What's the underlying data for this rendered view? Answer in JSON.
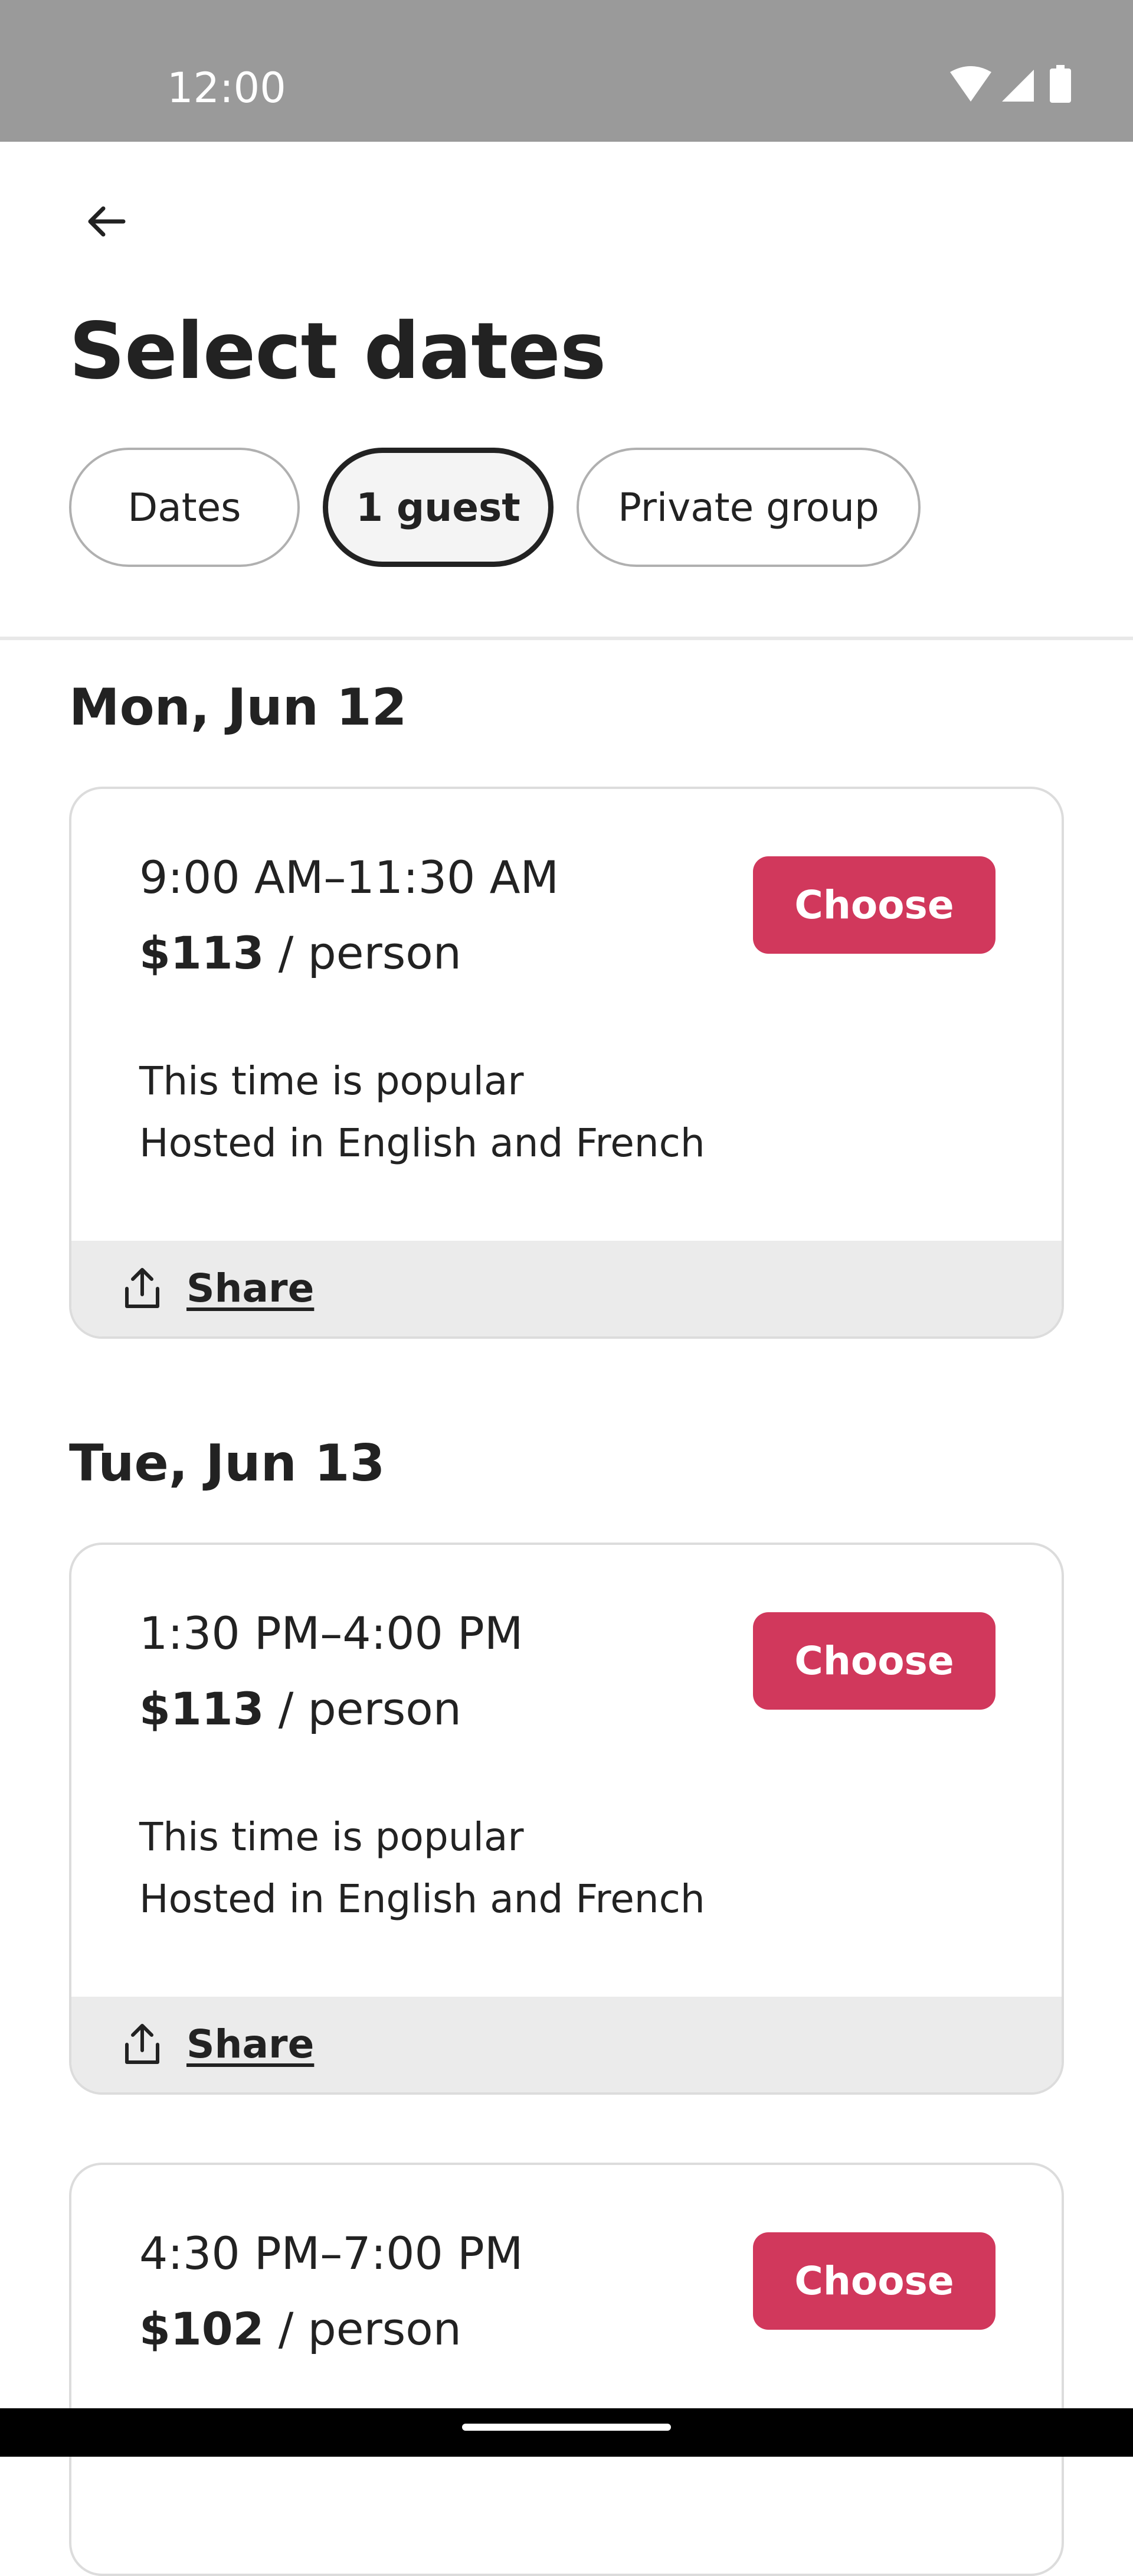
{
  "status_bar": {
    "time": "12:00",
    "icons": [
      "wifi-icon",
      "signal-icon",
      "battery-icon"
    ]
  },
  "header": {
    "back_icon": "arrow-left-icon",
    "title": "Select dates",
    "chips": [
      {
        "label": "Dates",
        "selected": false
      },
      {
        "label": "1 guest",
        "selected": true
      },
      {
        "label": "Private group",
        "selected": false
      }
    ]
  },
  "days": [
    {
      "heading": "Mon, Jun 12",
      "slots": [
        {
          "time": "9:00 AM–11:30 AM",
          "price": "$113",
          "price_unit": " / person",
          "choose_label": "Choose",
          "notes": [
            "This time is popular",
            "Hosted in English and French"
          ],
          "share_label": "Share"
        }
      ]
    },
    {
      "heading": "Tue, Jun 13",
      "slots": [
        {
          "time": "1:30 PM–4:00 PM",
          "price": "$113",
          "price_unit": " / person",
          "choose_label": "Choose",
          "notes": [
            "This time is popular",
            "Hosted in English and French"
          ],
          "share_label": "Share"
        },
        {
          "time": "4:30 PM–7:00 PM",
          "price": "$102",
          "price_unit": " / person",
          "choose_label": "Choose"
        }
      ]
    }
  ],
  "colors": {
    "accent": "#d1385c",
    "status_bar": "#9a9a9a",
    "footer_bg": "#ebebeb",
    "text": "#222222"
  }
}
